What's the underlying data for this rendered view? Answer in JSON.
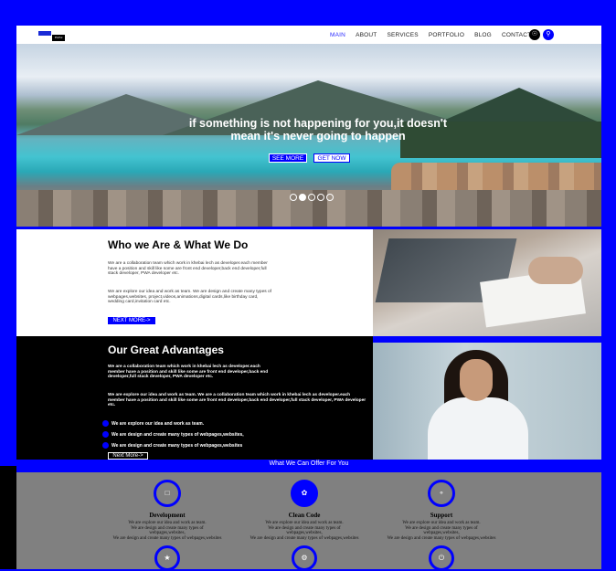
{
  "nav": {
    "logo_text": "PixPol",
    "menu": [
      "MAIN",
      "ABOUT",
      "SERVICES",
      "PORTFOLIO",
      "BLOG",
      "CONTACT"
    ],
    "cart_icon": "cart-icon",
    "search_icon": "search-icon"
  },
  "hero": {
    "headline": "if something is not happening for you,it doesn't mean it's never going to happen",
    "see_more": "SEE MORE",
    "get_now": "GET NOW",
    "slides": 5,
    "active_slide": 2
  },
  "who": {
    "title": "Who we Are & What We Do",
    "p1": "We are a collaboration team which work in khebai lech as developer.each member have a position and skill like some are front end developer,back end developer,full stack developer, PWA developer etc.",
    "p2": "We are explore our idea and work as team. We are design and create many types of webpages,websites, project,videos,animations,digital cards,like birthday card, wedding card,invitation card etc.",
    "button": "NEXT MORE->"
  },
  "advantages": {
    "title": "Our Great Advantages",
    "p1": "We are a collaboration team which work in khebai lech as developer.each member have a position and skill like some are front end developer,back end developer,full stack developer, PWA developer etc.",
    "p2": "We are explore our idea and work as team. We are a collaboration team which work in khebai lech as developer.each member have a position and skill like some are front end developer,back end developer,full stack developer, PWA developer etc.",
    "bullets": [
      "We are explore our idea and work as team.",
      "We are design and create many types of webpages,websites,",
      "We are design and create many types of webpages,websites"
    ],
    "button": "Next More->"
  },
  "offer": {
    "title": "What We Can Offer For You",
    "services": [
      {
        "name": "Development",
        "icon": "monitor-icon",
        "lines": [
          "We are explore our idea and work as team.",
          "We are design and create many types of webpages,websites,",
          "We are design and create many types of webpages,websites"
        ]
      },
      {
        "name": "Clean Code",
        "icon": "leaf-icon",
        "lines": [
          "We are explore our idea and work as team.",
          "We are design and create many types of webpages,websites,",
          "We are design and create many types of webpages,websites"
        ]
      },
      {
        "name": "Support",
        "icon": "key-icon",
        "lines": [
          "We are explore our idea and work as team.",
          "We are design and create many types of webpages,websites,",
          "We are design and create many types of webpages,websites"
        ]
      }
    ],
    "row2_icons": [
      "trophy-icon",
      "gear-icon",
      "power-icon"
    ]
  },
  "colors": {
    "accent": "#0000ff",
    "band": "#808080"
  }
}
